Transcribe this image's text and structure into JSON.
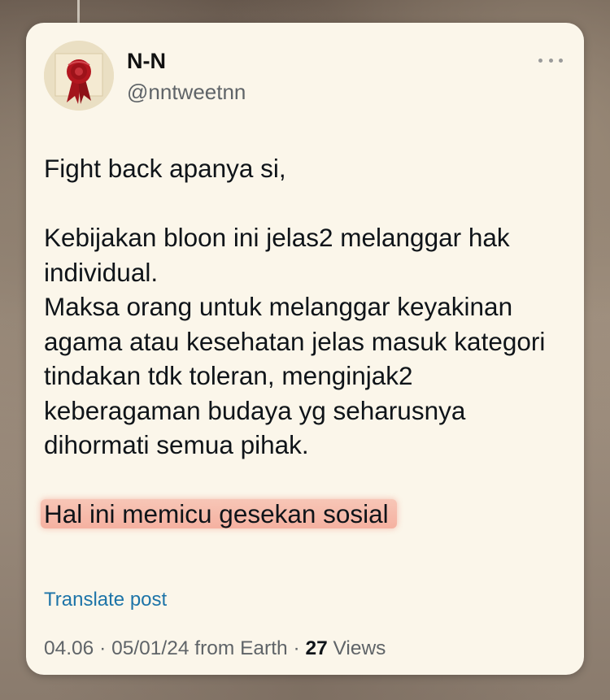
{
  "author": {
    "display_name": "N-N",
    "handle": "@nntweetnn",
    "avatar_icon": "wax-seal-icon"
  },
  "post": {
    "line1": "Fight back apanya si,",
    "paragraph2": [
      "Kebijakan bloon ini jelas2 melanggar hak",
      "individual.",
      "Maksa orang untuk melanggar keyakinan",
      "agama atau kesehatan jelas masuk kategori",
      "tindakan tdk toleran, menginjak2",
      "keberagaman budaya yg seharusnya",
      "dihormati semua pihak."
    ],
    "highlighted": "Hal ini memicu gesekan sosial"
  },
  "translate_label": "Translate post",
  "meta": {
    "time": "04.06",
    "date": "05/01/24",
    "source": "from Earth",
    "views_count": "27",
    "views_label": "Views"
  },
  "colors": {
    "card": "#fbf6ea",
    "link": "#1d74a8",
    "highlight": "#f28c78"
  }
}
